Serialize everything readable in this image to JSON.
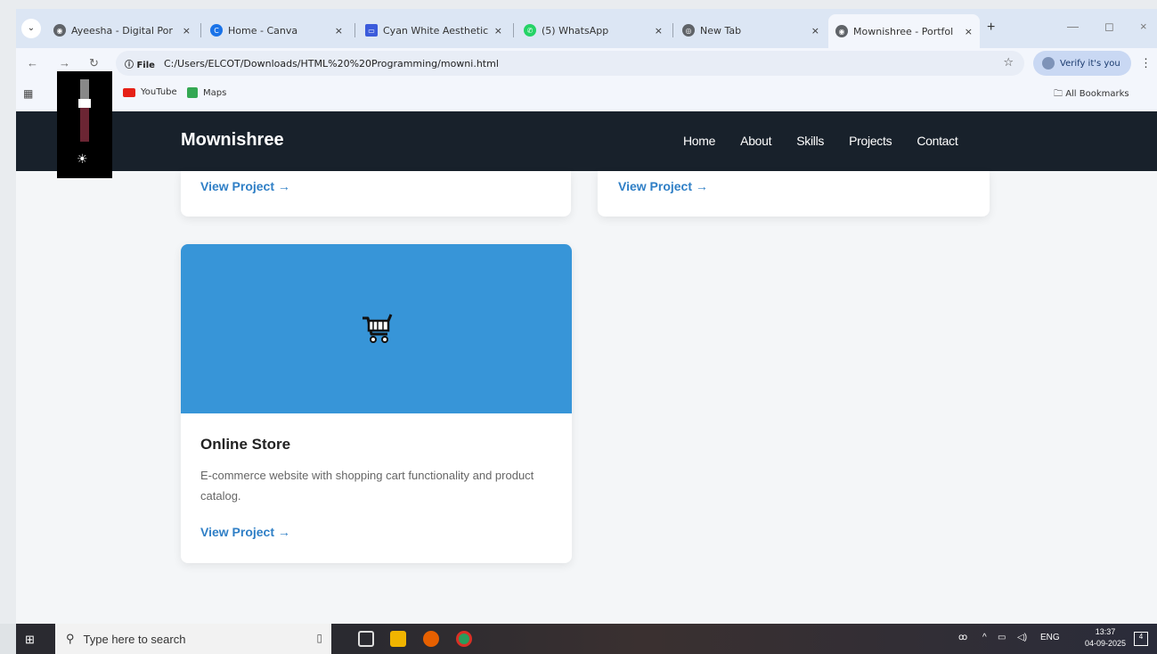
{
  "browser": {
    "tabs": [
      {
        "title": "Ayeesha - Digital Por",
        "favicon_color": "#5f6368"
      },
      {
        "title": "Home - Canva",
        "favicon_color": "#1a73e8"
      },
      {
        "title": "Cyan White Aesthetic",
        "favicon_color": "#3b5bdb"
      },
      {
        "title": "(5) WhatsApp",
        "favicon_color": "#25d366"
      },
      {
        "title": "New Tab",
        "favicon_color": "#5f6368"
      },
      {
        "title": "Mownishree - Portfol",
        "favicon_color": "#5f6368"
      }
    ],
    "tab_close": "×",
    "new_tab": "+",
    "minimize": "—",
    "maximize": "◻",
    "close": "×",
    "file_chip": "ⓘ File",
    "url": "C:/Users/ELCOT/Downloads/HTML%20%20Programming/mowni.html",
    "star": "☆",
    "verify_label": "Verify it's you",
    "kebab": "⋮",
    "bookmarks": [
      {
        "label": "YouTube",
        "color": "#e62117"
      },
      {
        "label": "Maps",
        "color": "#34a853"
      }
    ],
    "all_bookmarks": "All Bookmarks",
    "apps_icon": "▦"
  },
  "site": {
    "logo": "Mownishree",
    "nav": [
      "Home",
      "About",
      "Skills",
      "Projects",
      "Contact"
    ],
    "view_project": "View Project →",
    "project": {
      "title": "Online Store",
      "description": "E-commerce website with shopping cart functionality and product catalog.",
      "banner_color": "#3795d8",
      "icon": "cart-icon"
    }
  },
  "brightness": {
    "level": 0.62,
    "sun": "☀"
  },
  "taskbar": {
    "start": "⊞",
    "search_placeholder": "Type here to search",
    "search_icon": "⚲",
    "mic": "🎙",
    "tray_lang": "ENG",
    "time": "13:37",
    "date": "04-09-2025",
    "notifications": "4"
  }
}
